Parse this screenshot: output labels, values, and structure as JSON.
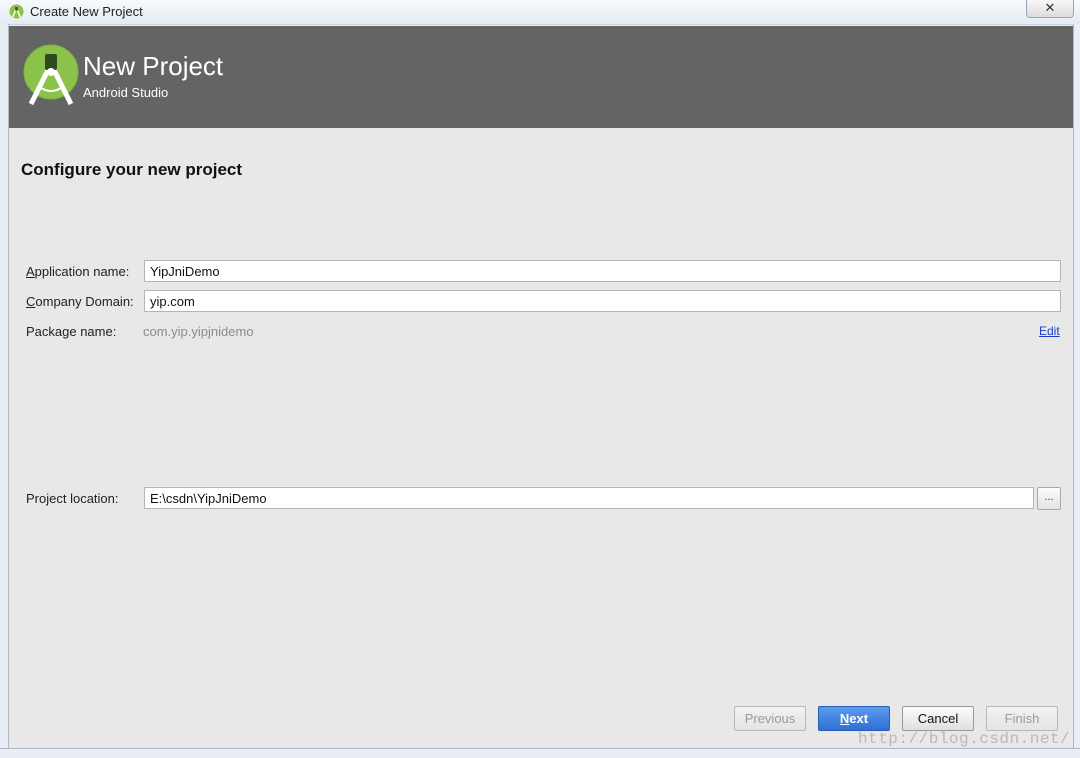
{
  "window": {
    "title": "Create New Project",
    "close_glyph": "✕"
  },
  "banner": {
    "title": "New Project",
    "subtitle": "Android Studio",
    "logo_icon": "android-studio-logo-icon"
  },
  "page": {
    "heading": "Configure your new project"
  },
  "form": {
    "app_name": {
      "mnemonic": "A",
      "label_rest": "pplication name:",
      "value": "YipJniDemo"
    },
    "company_domain": {
      "mnemonic": "C",
      "label_rest": "ompany Domain:",
      "value": "yip.com"
    },
    "package_name": {
      "label": "Package name:",
      "value": "com.yip.yipjnidemo",
      "edit_label": "Edit"
    },
    "project_location": {
      "label": "Project location:",
      "value": "E:\\csdn\\YipJniDemo",
      "browse_label": "..."
    }
  },
  "buttons": {
    "previous": "Previous",
    "next_mnemonic": "N",
    "next_rest": "ext",
    "cancel": "Cancel",
    "finish": "Finish"
  },
  "colors": {
    "banner": "#646464",
    "dialog_bg": "#e8e8e8",
    "primary_button": "#3b7de0",
    "link": "#1f3dc7",
    "logo_green": "#8bc34a"
  },
  "watermark": "http://blog.csdn.net/"
}
